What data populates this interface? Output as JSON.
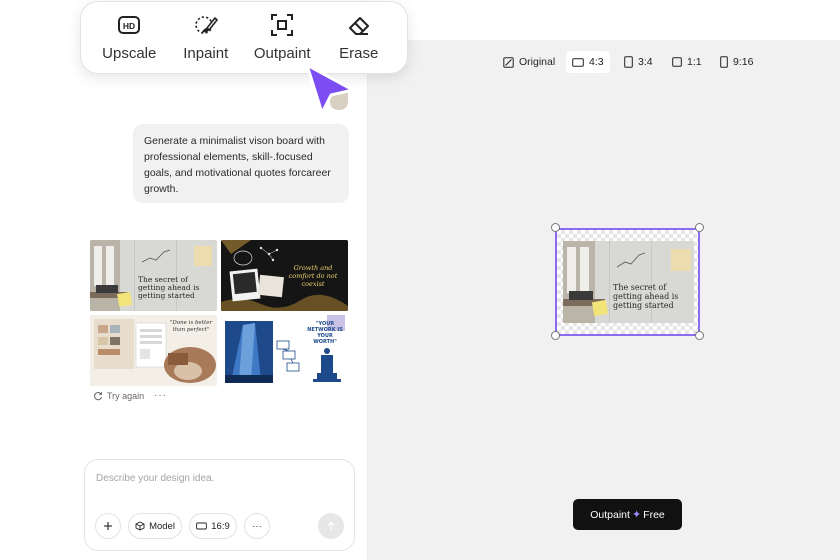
{
  "toolbar": {
    "tools": [
      {
        "label": "Upscale",
        "icon": "hd-icon"
      },
      {
        "label": "Inpaint",
        "icon": "brush-icon"
      },
      {
        "label": "Outpaint",
        "icon": "expand-icon"
      },
      {
        "label": "Erase",
        "icon": "eraser-icon"
      }
    ]
  },
  "chat": {
    "prompt": "Generate a minimalist vison board with professional elements, skill-.focused goals, and motivational quotes forcareer growth.",
    "thumbnails": {
      "t1_quote": "The secret of getting ahead is getting started",
      "t2_quote": "Growth and comfort do not coexist",
      "t3_quote": "\"Done is better than perfect\"",
      "t4_quote": "\"YOUR NETWORK IS YOUR WORTH\""
    },
    "try_again_label": "Try again",
    "more_label": "···"
  },
  "input": {
    "placeholder": "Describe your design idea.",
    "model_label": "Model",
    "ratio_label": "16:9",
    "more_label": "···"
  },
  "aspect_options": [
    {
      "label": "Original"
    },
    {
      "label": "4:3",
      "selected": true
    },
    {
      "label": "3:4"
    },
    {
      "label": "1:1"
    },
    {
      "label": "9:16"
    }
  ],
  "canvas": {
    "image_quote": "The secret of getting ahead is getting started"
  },
  "outpaint_button": {
    "label": "Outpaint",
    "suffix": "Free"
  },
  "colors": {
    "accent": "#8b6cf0",
    "cursor": "#7b4df2",
    "button_bg": "#111111"
  }
}
